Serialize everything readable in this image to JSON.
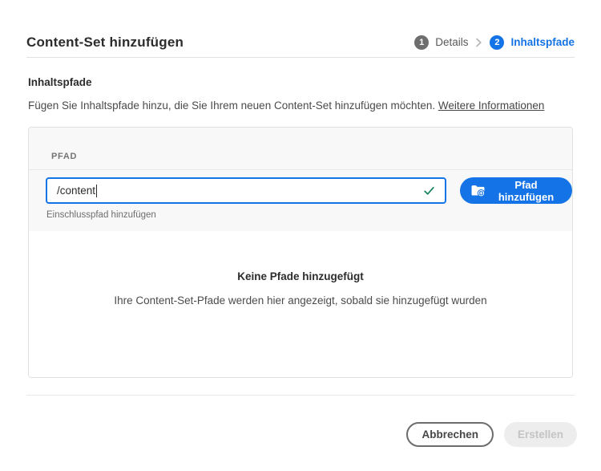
{
  "header": {
    "title": "Content-Set hinzufügen",
    "steps": [
      {
        "number": "1",
        "label": "Details",
        "state": "done"
      },
      {
        "number": "2",
        "label": "Inhaltspfade",
        "state": "current"
      }
    ]
  },
  "intro": {
    "heading": "Inhaltspfade",
    "description": "Fügen Sie Inhaltspfade hinzu, die Sie Ihrem neuen Content-Set hinzufügen möchten.",
    "link_label": "Weitere Informationen"
  },
  "form": {
    "column_header": "PFAD",
    "path_value": "/content",
    "helper_text": "Einschlusspfad hinzufügen",
    "add_button_label": "Pfad hinzufügen"
  },
  "empty_state": {
    "title": "Keine Pfade hinzugefügt",
    "description": "Ihre Content-Set-Pfade werden hier angezeigt, sobald sie hinzugefügt wurden"
  },
  "footer": {
    "cancel_label": "Abbrechen",
    "create_label": "Erstellen"
  },
  "colors": {
    "accent_blue": "#1473e6",
    "success_green": "#12805c",
    "step_gray": "#6e6e6e"
  }
}
